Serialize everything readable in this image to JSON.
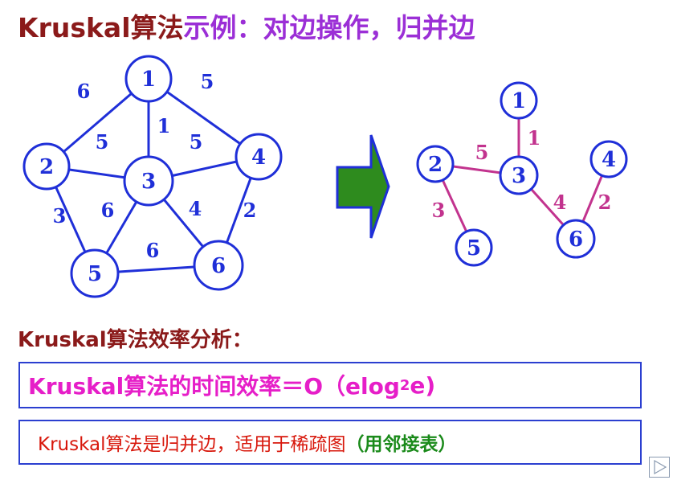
{
  "title": {
    "part1": "Kruskal算法",
    "part2": "示例：对边操作，归并边"
  },
  "graph_left": {
    "nodes": [
      "1",
      "2",
      "3",
      "4",
      "5",
      "6"
    ],
    "edges": [
      {
        "from": "1",
        "to": "2",
        "weight": "6"
      },
      {
        "from": "1",
        "to": "4",
        "weight": "5"
      },
      {
        "from": "1",
        "to": "3",
        "weight": "1"
      },
      {
        "from": "2",
        "to": "3",
        "weight": "5"
      },
      {
        "from": "3",
        "to": "4",
        "weight": "5"
      },
      {
        "from": "2",
        "to": "5",
        "weight": "3"
      },
      {
        "from": "3",
        "to": "5",
        "weight": "6"
      },
      {
        "from": "3",
        "to": "6",
        "weight": "4"
      },
      {
        "from": "4",
        "to": "6",
        "weight": "2"
      },
      {
        "from": "5",
        "to": "6",
        "weight": "6"
      }
    ]
  },
  "graph_right": {
    "nodes": [
      "1",
      "2",
      "3",
      "4",
      "5",
      "6"
    ],
    "edges": [
      {
        "from": "1",
        "to": "3",
        "weight": "1"
      },
      {
        "from": "2",
        "to": "3",
        "weight": "5"
      },
      {
        "from": "2",
        "to": "5",
        "weight": "3"
      },
      {
        "from": "3",
        "to": "6",
        "weight": "4"
      },
      {
        "from": "4",
        "to": "6",
        "weight": "2"
      }
    ]
  },
  "colors": {
    "node_stroke": "#1f2fd8",
    "left_edges": "#1f2fd8",
    "right_edges": "#c2338e",
    "arrow_fill": "#2e8b1e",
    "arrow_stroke": "#1f2fd8"
  },
  "section_heading": "Kruskal算法效率分析：",
  "efficiency": {
    "prefix": "Kruskal算法的时间效率＝O（elog",
    "subscript": "2",
    "suffix": "e)"
  },
  "note": {
    "main": "Kruskal算法是归并边，适用于稀疏图",
    "paren": "（用邻接表）"
  }
}
